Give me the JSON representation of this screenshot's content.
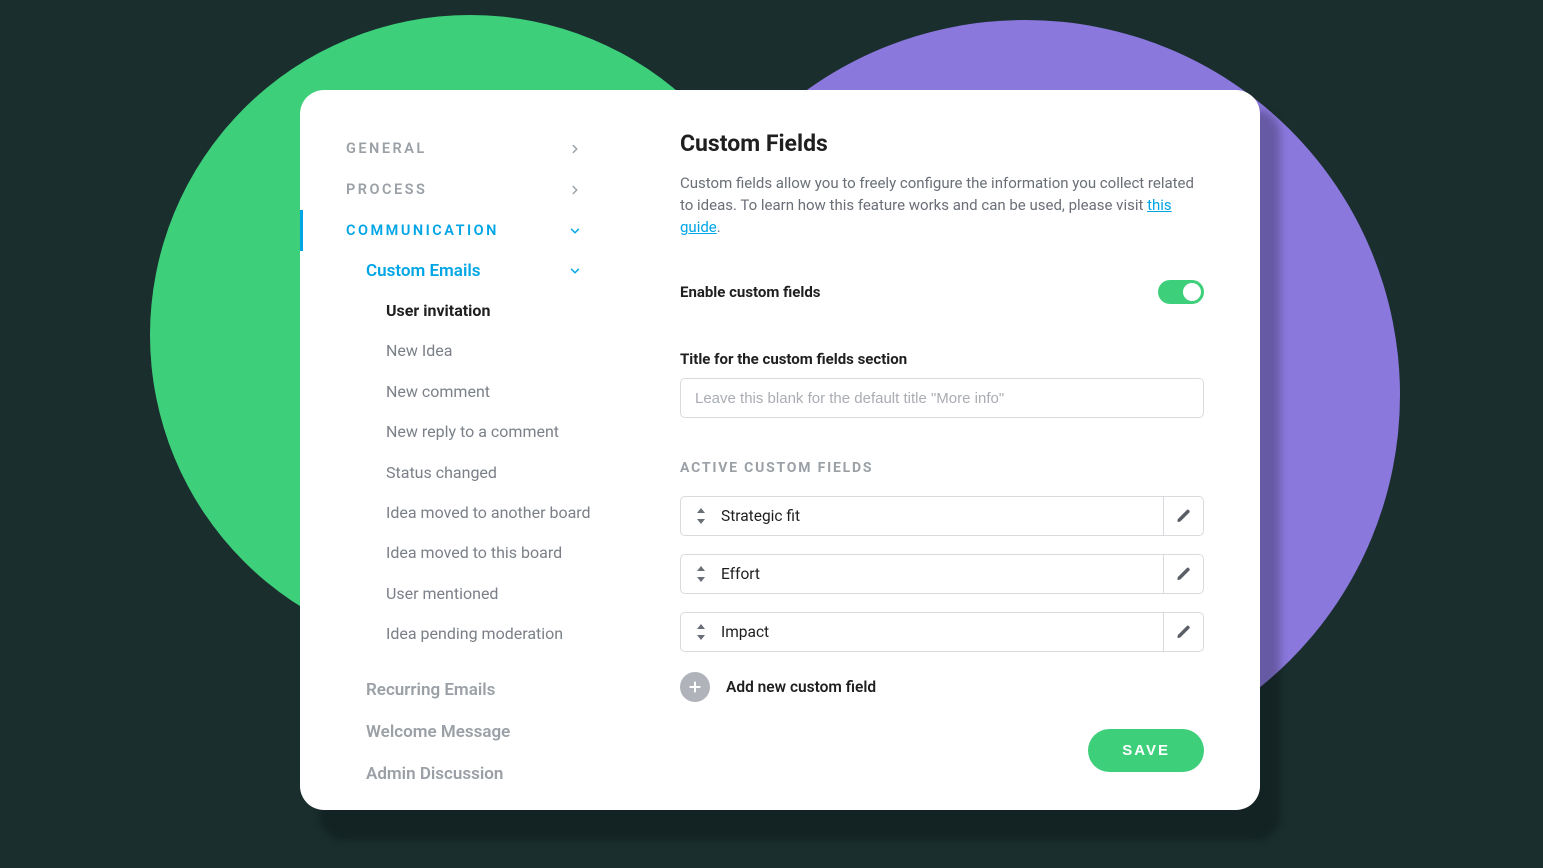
{
  "sidebar": {
    "general": "GENERAL",
    "process": "PROCESS",
    "communication": "COMMUNICATION",
    "custom_emails": "Custom Emails",
    "leaves": [
      "User invitation",
      "New Idea",
      "New comment",
      "New reply to a comment",
      "Status changed",
      "Idea moved to another board",
      "Idea moved to this board",
      "User mentioned",
      "Idea pending moderation"
    ],
    "recurring": "Recurring Emails",
    "welcome": "Welcome Message",
    "admin": "Admin Discussion"
  },
  "content": {
    "title": "Custom Fields",
    "desc1": "Custom fields allow you to freely configure the information you collect related to ideas. To learn how this feature works and can be used, please visit ",
    "guide": "this guide",
    "desc2": ".",
    "enable_label": "Enable custom fields",
    "enable_value": true,
    "title_label": "Title for the custom fields section",
    "title_placeholder": "Leave this blank for the default title \"More info\"",
    "title_value": "",
    "active_label": "ACTIVE CUSTOM FIELDS",
    "fields": [
      "Strategic fit",
      "Effort",
      "Impact"
    ],
    "add_label": "Add new custom field",
    "save": "SAVE"
  }
}
